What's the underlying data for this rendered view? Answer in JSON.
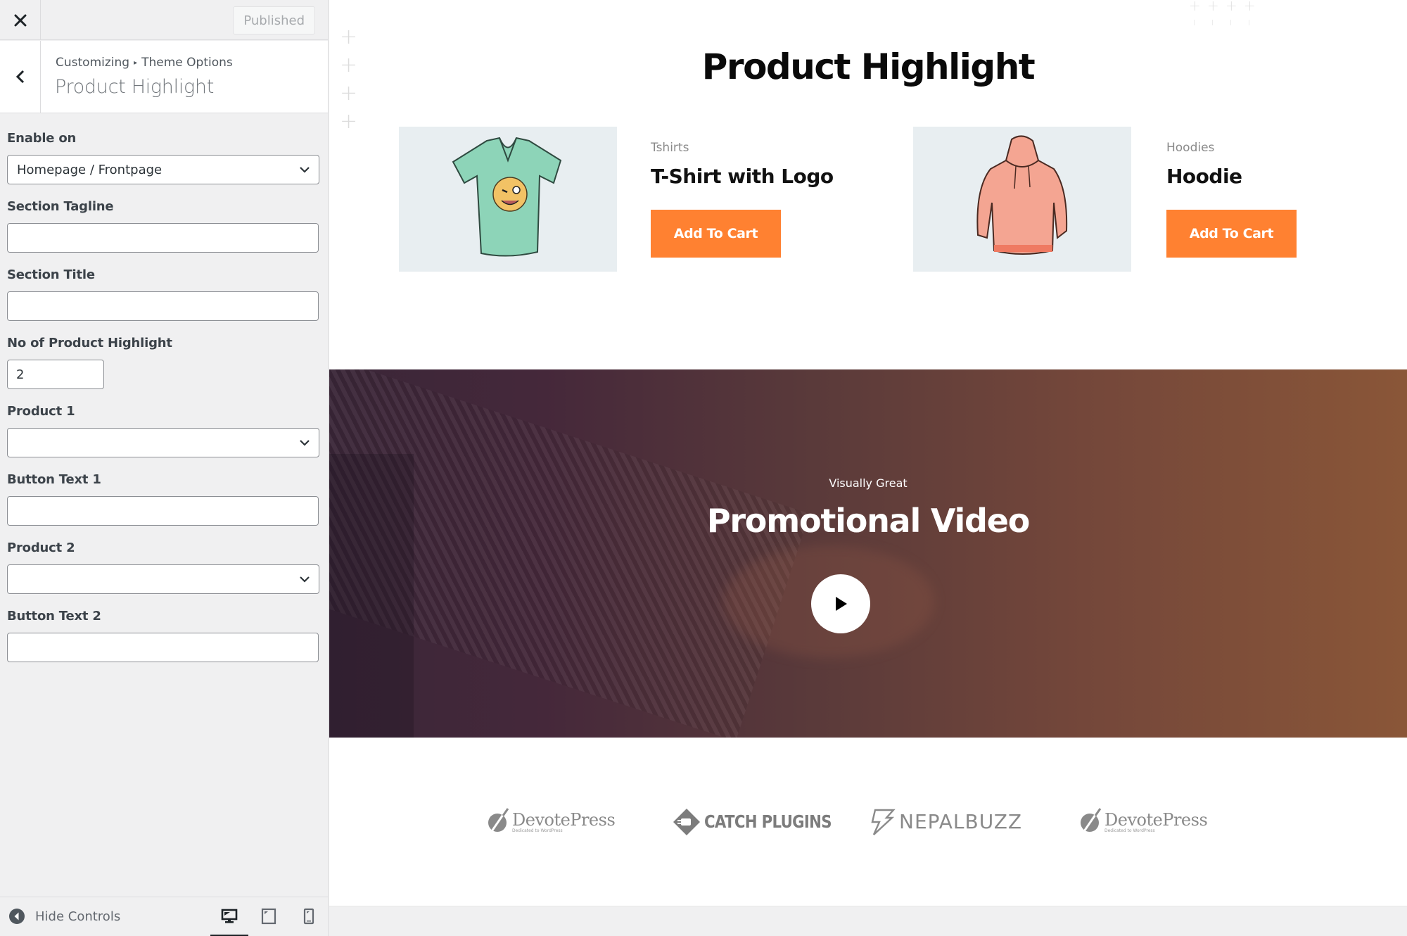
{
  "sidebar": {
    "close_label": "Close",
    "publish_button": "Published",
    "breadcrumb": {
      "root": "Customizing",
      "parent": "Theme Options"
    },
    "section_title": "Product Highlight",
    "controls": {
      "enable_on": {
        "label": "Enable on",
        "value": "Homepage / Frontpage"
      },
      "section_tagline": {
        "label": "Section Tagline",
        "value": ""
      },
      "section_title": {
        "label": "Section Title",
        "value": ""
      },
      "no_of_product_highlight": {
        "label": "No of Product Highlight",
        "value": "2"
      },
      "product_1": {
        "label": "Product 1",
        "value": ""
      },
      "button_text_1": {
        "label": "Button Text 1",
        "value": ""
      },
      "product_2": {
        "label": "Product 2",
        "value": ""
      },
      "button_text_2": {
        "label": "Button Text 2",
        "value": ""
      }
    },
    "footer": {
      "hide_controls": "Hide Controls",
      "devices": [
        "desktop",
        "tablet",
        "mobile"
      ],
      "active_device": "desktop"
    }
  },
  "preview": {
    "product_highlight": {
      "title": "Product Highlight",
      "products": [
        {
          "category": "Tshirts",
          "name": "T-Shirt with Logo",
          "button": "Add To Cart",
          "image": "t-shirt-illustration"
        },
        {
          "category": "Hoodies",
          "name": "Hoodie",
          "button": "Add To Cart",
          "image": "hoodie-illustration"
        }
      ]
    },
    "promo_video": {
      "tagline": "Visually Great",
      "title": "Promotional Video",
      "play_icon": "play-icon"
    },
    "logos": [
      {
        "name": "DevotePress",
        "subtitle": "Dedicated to WordPress"
      },
      {
        "name": "CATCH PLUGINS"
      },
      {
        "name": "NEPALBUZZ"
      },
      {
        "name": "DevotePress",
        "subtitle": "Dedicated to WordPress"
      }
    ]
  },
  "colors": {
    "accent_button": "#ff8131",
    "sidebar_bg": "#f0f0f1",
    "card_bg": "#e8eef1"
  }
}
